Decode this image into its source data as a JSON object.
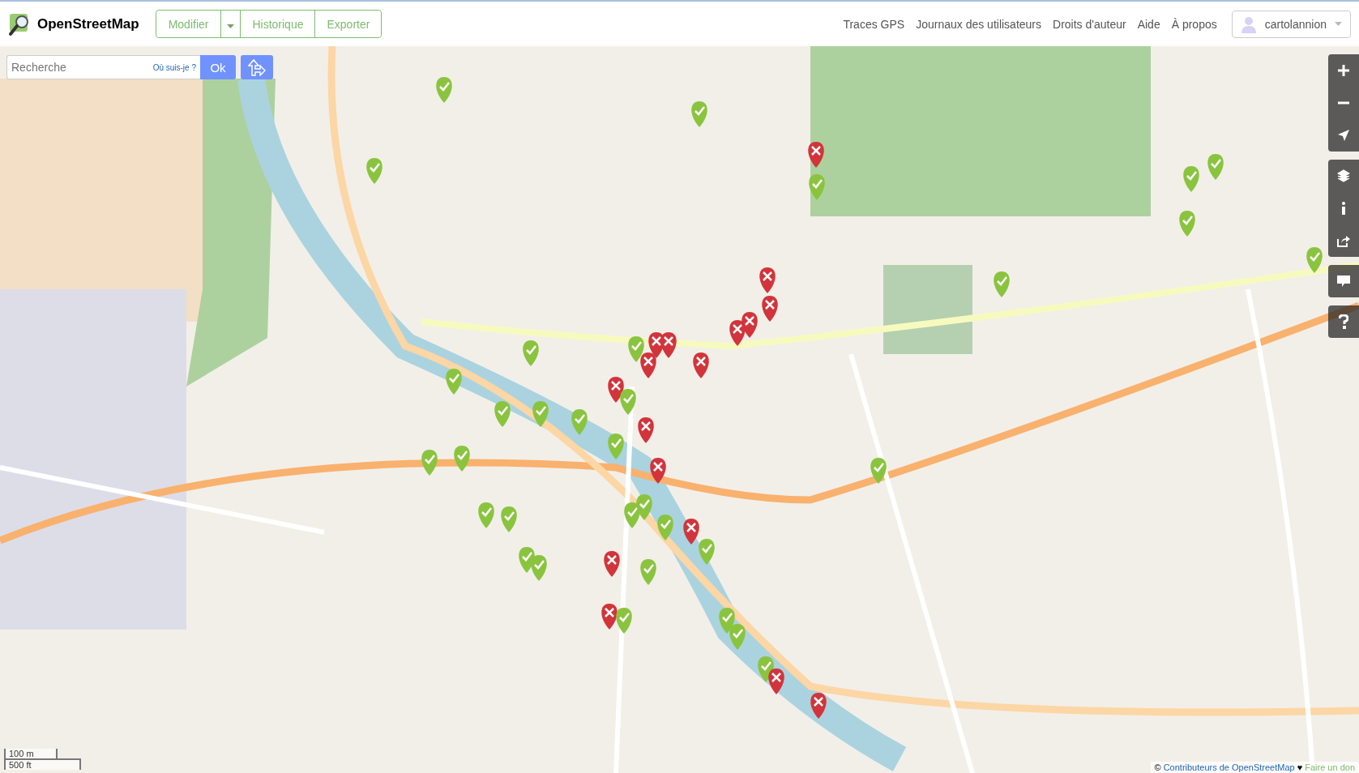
{
  "brand": {
    "name": "OpenStreetMap"
  },
  "edit_group": {
    "primary": "Modifier",
    "others": [
      "Historique",
      "Exporter"
    ]
  },
  "nav": [
    "Traces GPS",
    "Journaux des utilisateurs",
    "Droits d'auteur",
    "Aide",
    "À propos"
  ],
  "user": {
    "name": "cartolannion"
  },
  "search": {
    "placeholder": "Recherche",
    "locate_link": "Où suis-je ?",
    "submit": "Ok"
  },
  "map_controls": [
    {
      "kind": "zoom-in"
    },
    {
      "kind": "zoom-out"
    },
    {
      "kind": "locate"
    },
    {
      "kind": "layers"
    },
    {
      "kind": "info"
    },
    {
      "kind": "share"
    },
    {
      "kind": "note"
    },
    {
      "kind": "help"
    }
  ],
  "scale": {
    "metric": "100 m",
    "imperial": "500 ft"
  },
  "attribution": {
    "symbol": "©",
    "link": "Contributeurs de OpenStreetMap",
    "heart": "♥",
    "donate": "Faire un don"
  }
}
